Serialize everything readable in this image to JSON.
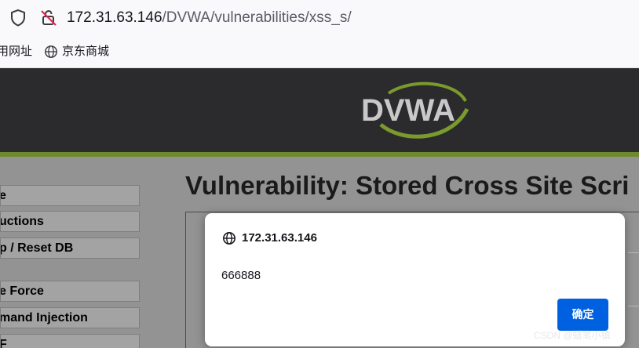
{
  "browser": {
    "url_host": "172.31.63.146",
    "url_path": "/DVWA/vulnerabilities/xss_s/",
    "bookmarks": [
      "用网址",
      "京东商城"
    ]
  },
  "logo": {
    "text": "DVWA"
  },
  "sidebar": {
    "items": [
      {
        "label": "e"
      },
      {
        "label": "uctions"
      },
      {
        "label": "p / Reset DB"
      },
      {
        "label": "e Force"
      },
      {
        "label": "mand Injection"
      },
      {
        "label": "F"
      }
    ]
  },
  "main": {
    "title": "Vulnerability: Stored Cross Site Scri"
  },
  "dialog": {
    "origin": "172.31.63.146",
    "message": "666888",
    "ok_label": "确定"
  },
  "watermark": "CSDN @蜡笔小镇",
  "colors": {
    "accent_blue": "#0061e0",
    "header_green": "#6e8a2c",
    "header_bg": "#2b2b2d"
  }
}
